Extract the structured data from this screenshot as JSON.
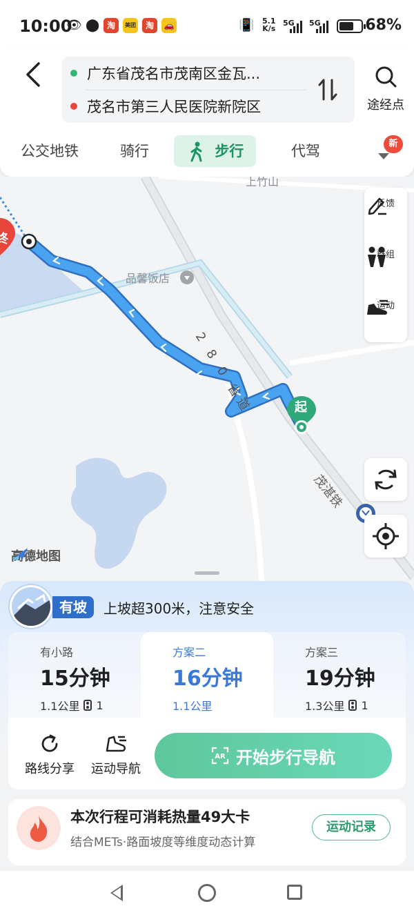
{
  "status_bar": {
    "time": "10:00",
    "speed": "5.1",
    "speed_unit": "K/s",
    "network_1": "5G",
    "network_2": "5G",
    "battery_text": "68%",
    "battery_level": 0.68,
    "app_icons": [
      "淘",
      "美团",
      "淘",
      "car-icon"
    ]
  },
  "header": {
    "start_location": "广东省茂名市茂南区金瓦...",
    "end_location": "茂名市第三人民医院新院区",
    "via_label": "途经点"
  },
  "tabs": [
    {
      "label": "公交地铁",
      "active": false
    },
    {
      "label": "骑行",
      "active": false
    },
    {
      "label": "步行",
      "active": true
    },
    {
      "label": "代驾",
      "active": false
    }
  ],
  "tabs_badge": "新",
  "map": {
    "labels": {
      "village": "上竹山",
      "restaurant": "品馨饭店",
      "road": "2 8 0 省道",
      "road2": "茂湛铁"
    },
    "start_marker": "起",
    "end_marker": "终",
    "logo": "高德地图",
    "tools": [
      {
        "label": "反馈",
        "icon": "feedback-pen-icon"
      },
      {
        "label": "群组",
        "icon": "group-people-icon"
      },
      {
        "label": "运动",
        "icon": "running-shoe-icon"
      }
    ]
  },
  "slope": {
    "tag": "有坡",
    "text": "上坡超300米，注意安全"
  },
  "plans": [
    {
      "name": "有小路",
      "duration": "15分钟",
      "distance": "1.1公里",
      "lights": "1",
      "active": false
    },
    {
      "name": "方案二",
      "duration": "16分钟",
      "distance": "1.1公里",
      "lights": "",
      "active": true
    },
    {
      "name": "方案三",
      "duration": "19分钟",
      "distance": "1.3公里",
      "lights": "1",
      "active": false
    }
  ],
  "actions": {
    "share_label": "路线分享",
    "sport_nav_label": "运动导航",
    "start_nav_label": "开始步行导航"
  },
  "calorie": {
    "title": "本次行程可消耗热量49大卡",
    "subtitle": "结合METs·路面坡度等维度动态计算",
    "button": "运动记录"
  },
  "colors": {
    "accent_green": "#1a9464",
    "route_blue": "#3b8de0",
    "active_plan_blue": "#3b79d8",
    "start_green": "#2fa87a",
    "end_red": "#e8453c"
  }
}
